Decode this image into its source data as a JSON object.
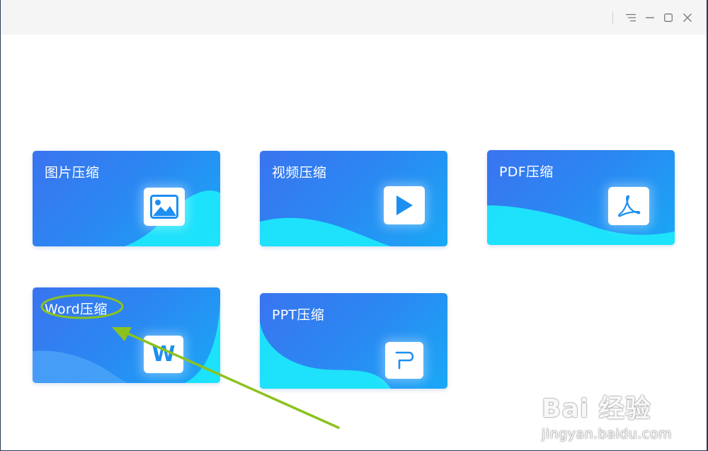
{
  "titlebar": {
    "menu_icon": "menu-icon",
    "minimize_icon": "minimize-icon",
    "maximize_icon": "maximize-icon",
    "close_icon": "close-icon"
  },
  "cards": [
    {
      "id": "image",
      "title": "图片压缩",
      "icon": "image-icon"
    },
    {
      "id": "video",
      "title": "视频压缩",
      "icon": "play-icon"
    },
    {
      "id": "pdf",
      "title": "PDF压缩",
      "icon": "pdf-icon"
    },
    {
      "id": "word",
      "title": "Word压缩",
      "icon": "word-icon"
    },
    {
      "id": "ppt",
      "title": "PPT压缩",
      "icon": "ppt-icon"
    }
  ],
  "icon_glyphs": {
    "word": "W"
  },
  "annotation": {
    "color": "#8cc21f",
    "highlighted": "Word压缩"
  },
  "watermark": {
    "logo": "Bai 经验",
    "url": "jingyan.baidu.com"
  },
  "colors": {
    "card_gradient_start": "#3a74ef",
    "card_gradient_end": "#19a8f6",
    "wave": "#1ee6fb",
    "icon_blue": "#1d8ff0"
  }
}
